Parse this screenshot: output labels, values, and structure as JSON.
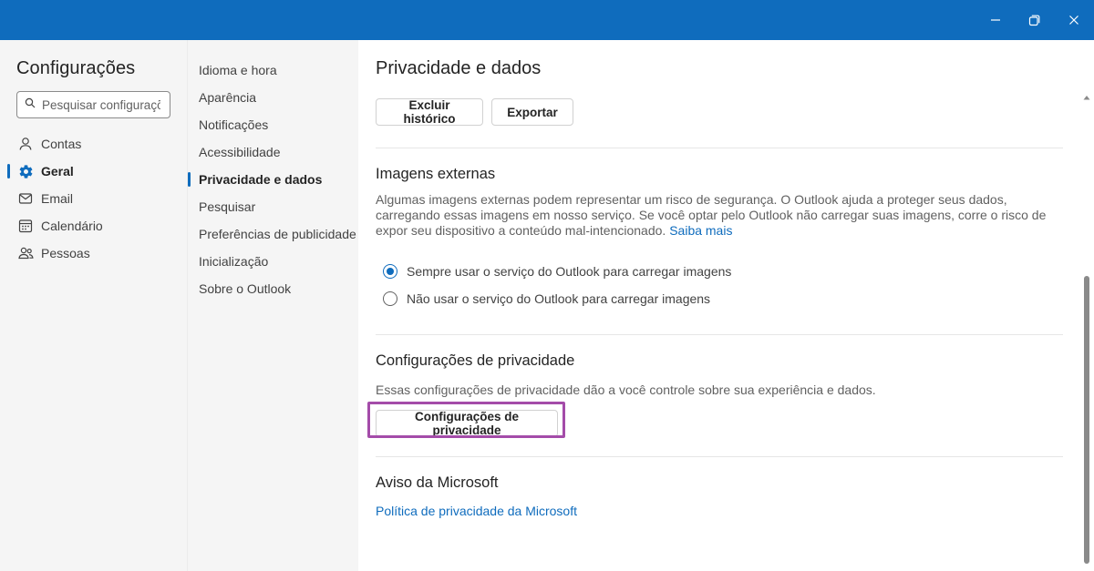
{
  "window": {
    "controls": [
      {
        "name": "minimize-icon"
      },
      {
        "name": "restore-icon"
      },
      {
        "name": "close-icon"
      }
    ]
  },
  "sidebar": {
    "title": "Configurações",
    "search_placeholder": "Pesquisar configurações",
    "items": [
      {
        "label": "Contas",
        "icon": "person-icon"
      },
      {
        "label": "Geral",
        "icon": "gear-icon",
        "active": true
      },
      {
        "label": "Email",
        "icon": "mail-icon"
      },
      {
        "label": "Calendário",
        "icon": "calendar-icon"
      },
      {
        "label": "Pessoas",
        "icon": "people-icon"
      }
    ]
  },
  "subnav": {
    "items": [
      {
        "label": "Idioma e hora"
      },
      {
        "label": "Aparência"
      },
      {
        "label": "Notificações"
      },
      {
        "label": "Acessibilidade"
      },
      {
        "label": "Privacidade e dados",
        "active": true
      },
      {
        "label": "Pesquisar"
      },
      {
        "label": "Preferências de publicidade"
      },
      {
        "label": "Inicialização"
      },
      {
        "label": "Sobre o Outlook"
      }
    ]
  },
  "main": {
    "title": "Privacidade e dados",
    "history": {
      "delete_label": "Excluir histórico",
      "export_label": "Exportar"
    },
    "external_images": {
      "title": "Imagens externas",
      "description": "Algumas imagens externas podem representar um risco de segurança. O Outlook ajuda a proteger seus dados, carregando essas imagens em nosso serviço. Se você optar pelo Outlook não carregar suas imagens, corre o risco de expor seu dispositivo a conteúdo mal-intencionado.",
      "learn_more": "Saiba mais",
      "options": [
        {
          "label": "Sempre usar o serviço do Outlook para carregar imagens",
          "checked": true
        },
        {
          "label": "Não usar o serviço do Outlook para carregar imagens",
          "checked": false
        }
      ]
    },
    "privacy_settings": {
      "title": "Configurações de privacidade",
      "description": "Essas configurações de privacidade dão a você controle sobre sua experiência e dados.",
      "button_label": "Configurações de privacidade"
    },
    "microsoft_notice": {
      "title": "Aviso da Microsoft",
      "link_label": "Política de privacidade da Microsoft"
    }
  },
  "colors": {
    "titlebar": "#0f6cbd",
    "accent": "#0f6cbd",
    "highlight": "#a44ca9",
    "nav_background": "#f5f5f5"
  }
}
